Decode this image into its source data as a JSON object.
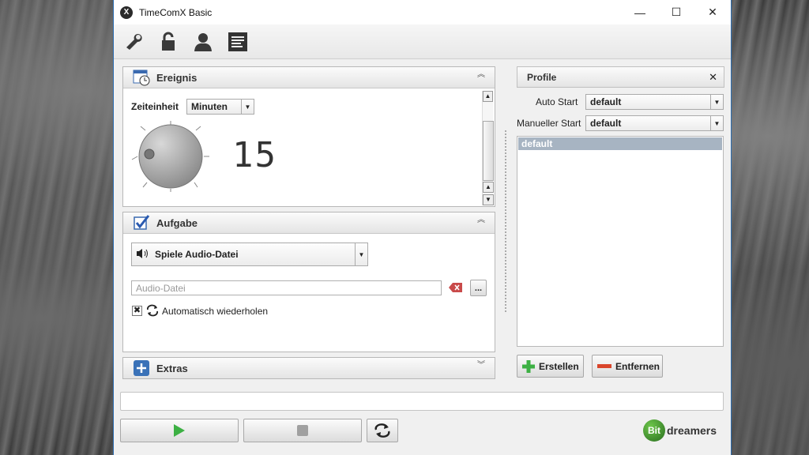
{
  "window": {
    "title": "TimeComX Basic",
    "app_icon_glyph": "X"
  },
  "titlebar": {
    "minimize": "—",
    "maximize": "☐",
    "close": "✕"
  },
  "toolbar": {
    "icons": [
      "wrench-icon",
      "unlock-icon",
      "user-icon",
      "log-icon"
    ]
  },
  "ereignis": {
    "title": "Ereignis",
    "unit_label": "Zeiteinheit",
    "unit_value": "Minuten",
    "display_value": "15"
  },
  "aufgabe": {
    "title": "Aufgabe",
    "action_value": "Spiele Audio-Datei",
    "file_placeholder": "Audio-Datei",
    "browse_label": "...",
    "repeat_label": "Automatisch wiederholen",
    "repeat_checked": true
  },
  "extras": {
    "title": "Extras"
  },
  "profile": {
    "title": "Profile",
    "close": "✕",
    "auto_start_label": "Auto Start",
    "auto_start_value": "default",
    "manual_start_label": "Manueller Start",
    "manual_start_value": "default",
    "list": [
      "default"
    ],
    "create_label": "Erstellen",
    "remove_label": "Entfernen"
  },
  "footer": {
    "brand_prefix": "Bit",
    "brand_suffix": "dreamers"
  },
  "colors": {
    "accent_blue": "#2b6cb0",
    "play_green": "#3cb043",
    "remove_red": "#d9452b",
    "selection": "#a7b4c2"
  }
}
